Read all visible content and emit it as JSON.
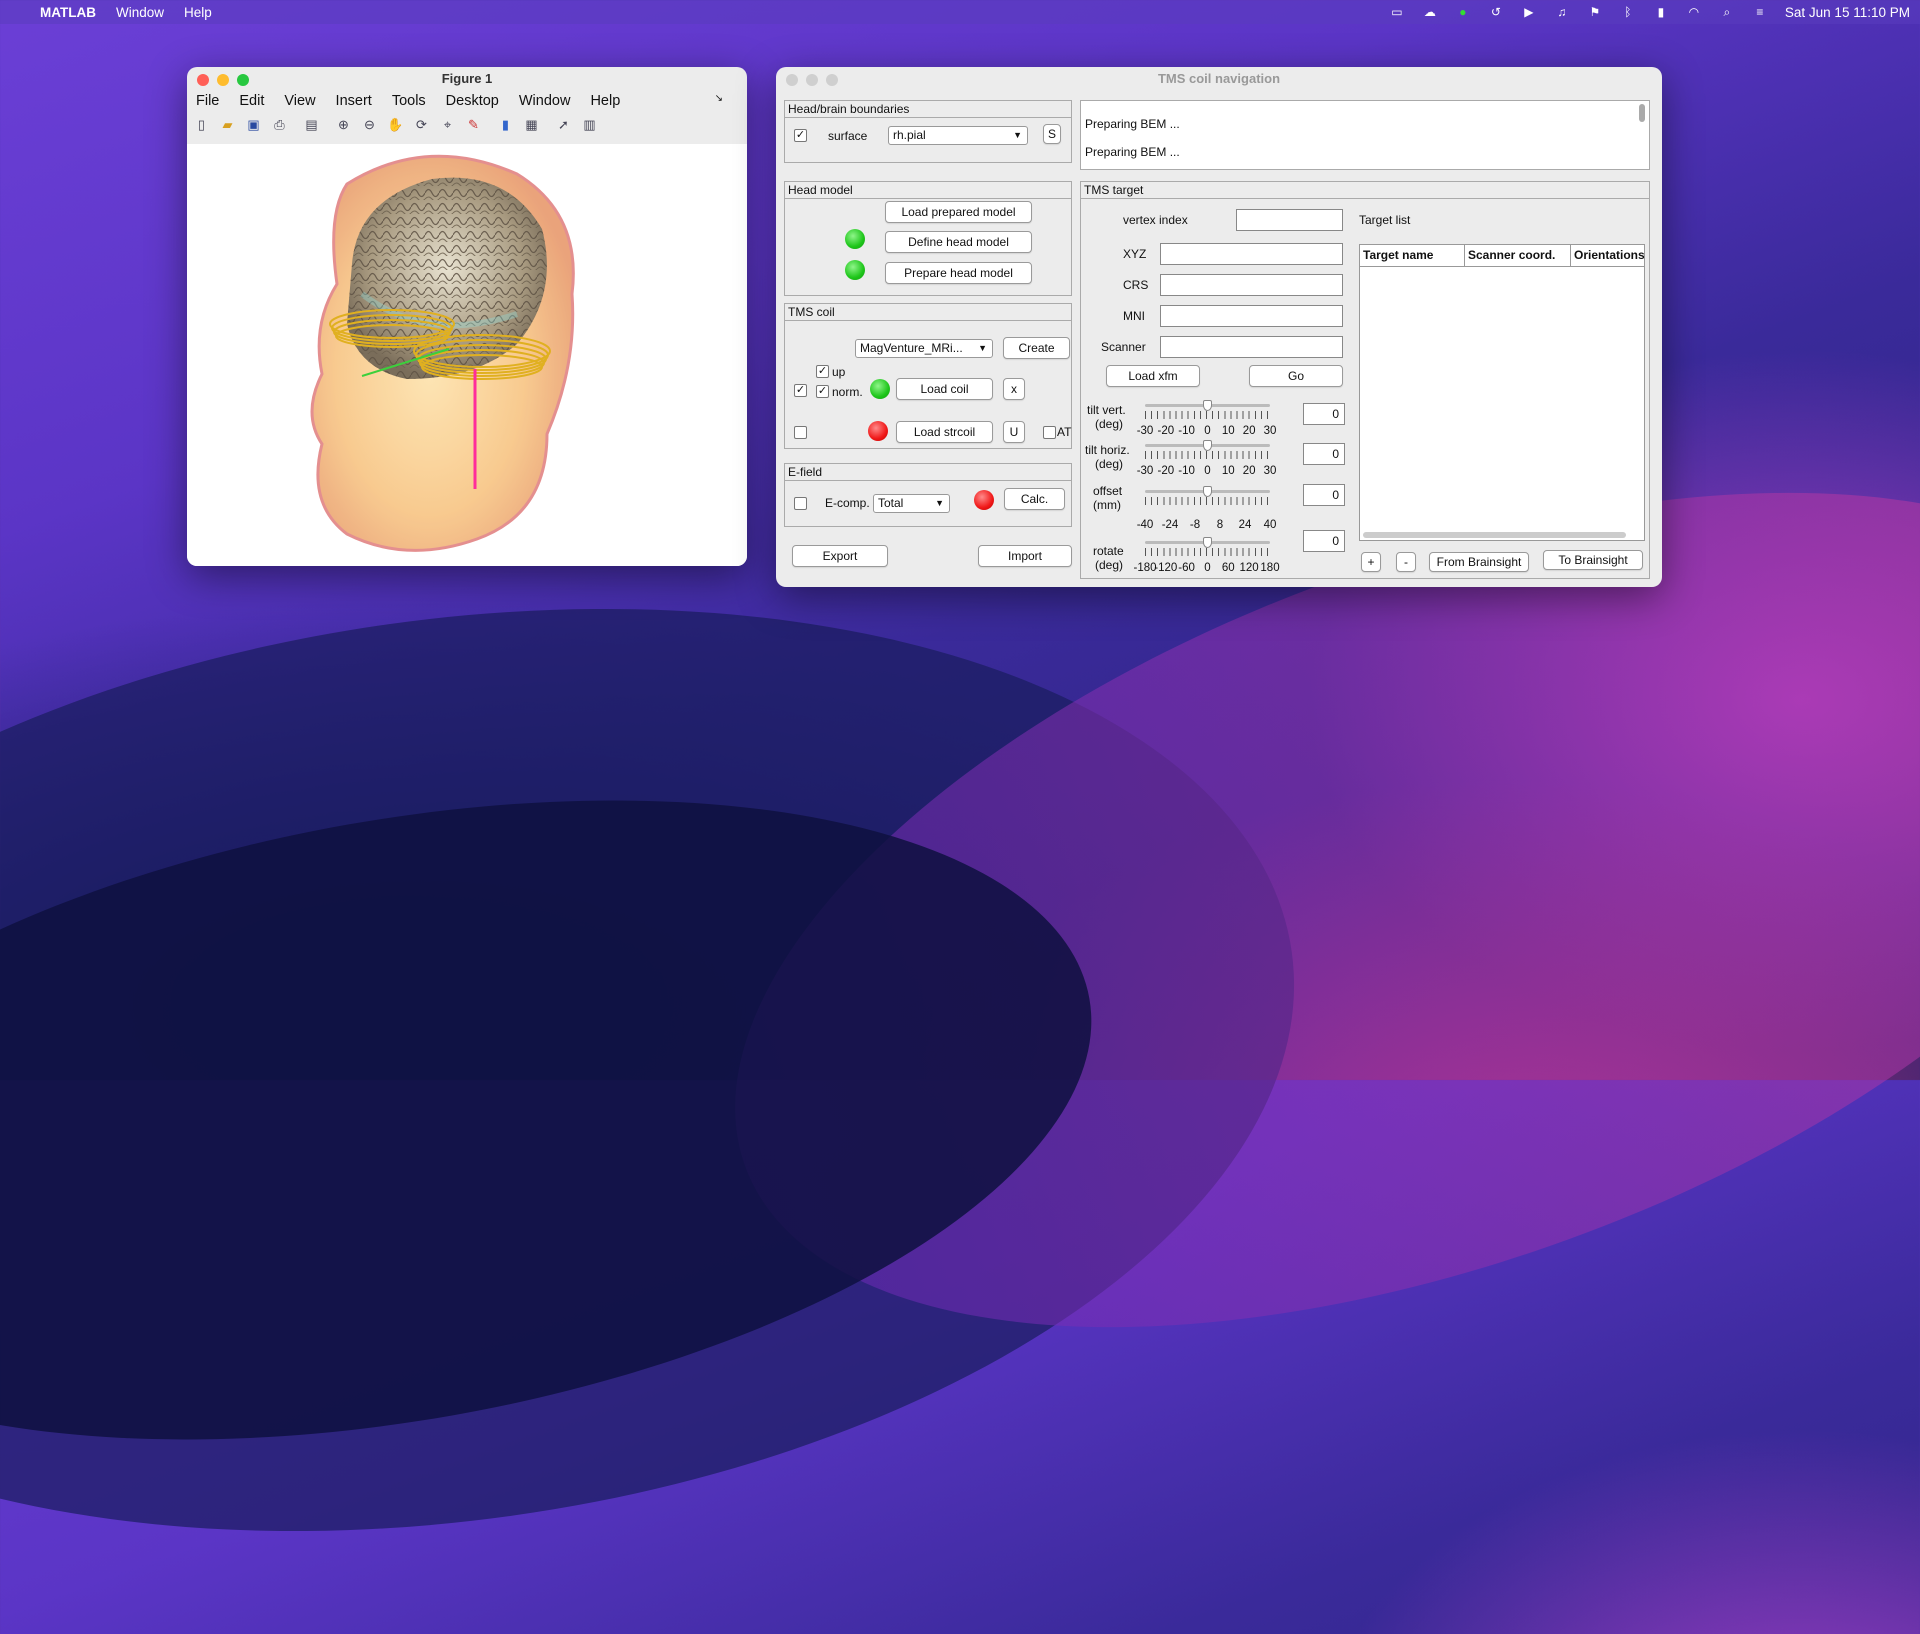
{
  "menubar": {
    "app": "MATLAB",
    "items": [
      "Window",
      "Help"
    ],
    "clock": "Sat Jun 15  11:10 PM"
  },
  "figure": {
    "title": "Figure 1",
    "menu": [
      "File",
      "Edit",
      "View",
      "Insert",
      "Tools",
      "Desktop",
      "Window",
      "Help"
    ],
    "toolbar_icons": [
      "new-figure-icon",
      "open-icon",
      "save-icon",
      "print-icon",
      "print-preview-icon",
      "zoom-in-icon",
      "zoom-out-icon",
      "pan-icon",
      "rotate-3d-icon",
      "data-cursor-icon",
      "brush-icon",
      "colorbar-icon",
      "legend-icon",
      "edit-plot-icon",
      "property-inspector-icon"
    ]
  },
  "tms": {
    "title": "TMS coil navigation",
    "log": [
      "Preparing BEM ...",
      "Preparing BEM ..."
    ],
    "boundaries": {
      "title": "Head/brain boundaries",
      "surface_label": "surface",
      "surface_value": "rh.pial",
      "s_btn": "S"
    },
    "head_model": {
      "title": "Head model",
      "load": "Load prepared model",
      "define": "Define head model",
      "prepare": "Prepare head model"
    },
    "coil": {
      "title": "TMS coil",
      "coil_value": "MagVenture_MRi...",
      "create": "Create",
      "up": "up",
      "norm": "norm.",
      "load_coil": "Load coil",
      "x_btn": "x",
      "load_strcoil": "Load strcoil",
      "u_btn": "U",
      "at": "AT"
    },
    "efield": {
      "title": "E-field",
      "ecomp_label": "E-comp.",
      "ecomp_value": "Total",
      "calc": "Calc."
    },
    "export": "Export",
    "import": "Import",
    "target": {
      "title": "TMS target",
      "vertex_label": "vertex index",
      "xyz": "XYZ",
      "crs": "CRS",
      "mni": "MNI",
      "scanner": "Scanner",
      "load_xfm": "Load xfm",
      "go": "Go",
      "tilt_vert": {
        "label1": "tilt vert.",
        "label2": "(deg)",
        "value": "0",
        "ticks": [
          "-30",
          "-20",
          "-10",
          "0",
          "10",
          "20",
          "30"
        ]
      },
      "tilt_horiz": {
        "label1": "tilt horiz.",
        "label2": "(deg)",
        "value": "0",
        "ticks": [
          "-30",
          "-20",
          "-10",
          "0",
          "10",
          "20",
          "30"
        ]
      },
      "offset": {
        "label1": "offset",
        "label2": "(mm)",
        "value": "0",
        "ticks": [
          "-40",
          "-24",
          "-8",
          "8",
          "24",
          "40"
        ]
      },
      "rotate": {
        "label1": "rotate",
        "label2": "(deg)",
        "value": "0",
        "ticks": [
          "-180",
          "-120",
          "-60",
          "0",
          "60",
          "120",
          "180"
        ]
      }
    },
    "target_list": {
      "title": "Target list",
      "columns": [
        "Target name",
        "Scanner coord.",
        "Orientations"
      ],
      "plus": "+",
      "minus": "-",
      "from": "From Brainsight",
      "to": "To Brainsight"
    }
  }
}
